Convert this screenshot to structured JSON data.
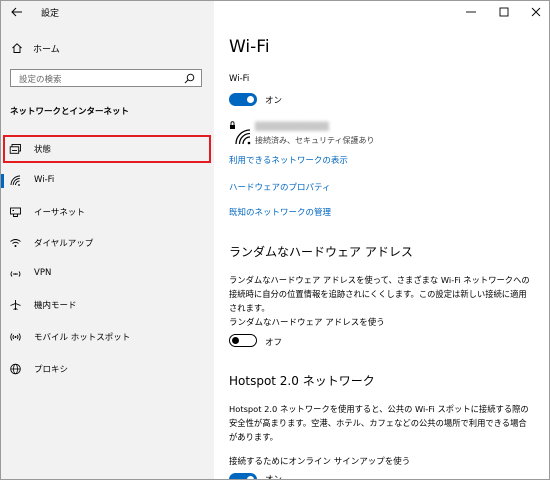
{
  "window": {
    "title": "設定"
  },
  "sidebar": {
    "home_label": "ホーム",
    "search_placeholder": "設定の検索",
    "section_title": "ネットワークとインターネット",
    "items": [
      {
        "label": "状態",
        "icon": "status-icon"
      },
      {
        "label": "Wi-Fi",
        "icon": "wifi-icon"
      },
      {
        "label": "イーサネット",
        "icon": "ethernet-icon"
      },
      {
        "label": "ダイヤルアップ",
        "icon": "dialup-icon"
      },
      {
        "label": "VPN",
        "icon": "vpn-icon"
      },
      {
        "label": "機内モード",
        "icon": "airplane-icon"
      },
      {
        "label": "モバイル ホットスポット",
        "icon": "hotspot-icon"
      },
      {
        "label": "プロキシ",
        "icon": "proxy-icon"
      }
    ],
    "selected_item": "Wi-Fi",
    "highlighted_item": "状態"
  },
  "main": {
    "title": "Wi-Fi",
    "wifi": {
      "label": "Wi-Fi",
      "state": "オン",
      "enabled": true
    },
    "network": {
      "status": "接続済み、セキュリティ保護あり"
    },
    "links": [
      "利用できるネットワークの表示",
      "ハードウェアのプロパティ",
      "既知のネットワークの管理"
    ],
    "random_hw": {
      "heading": "ランダムなハードウェア アドレス",
      "description": "ランダムなハードウェア アドレスを使って、さまざまな Wi-Fi ネットワークへの接続時に自分の位置情報を追跡されにくくします。この設定は新しい接続に適用されます。",
      "toggle_label": "ランダムなハードウェア アドレスを使う",
      "state": "オフ",
      "enabled": false
    },
    "hotspot20": {
      "heading": "Hotspot 2.0 ネットワーク",
      "description": "Hotspot 2.0 ネットワークを使用すると、公共の Wi-Fi スポットに接続する際の安全性が高まります。空港、ホテル、カフェなどの公共の場所で利用できる場合があります。",
      "toggle_label": "接続するためにオンライン サインアップを使う",
      "state": "オン",
      "enabled": true
    }
  },
  "colors": {
    "accent": "#0067c0",
    "highlight": "#e31c23",
    "sidebar_bg": "#f2f2f2"
  }
}
